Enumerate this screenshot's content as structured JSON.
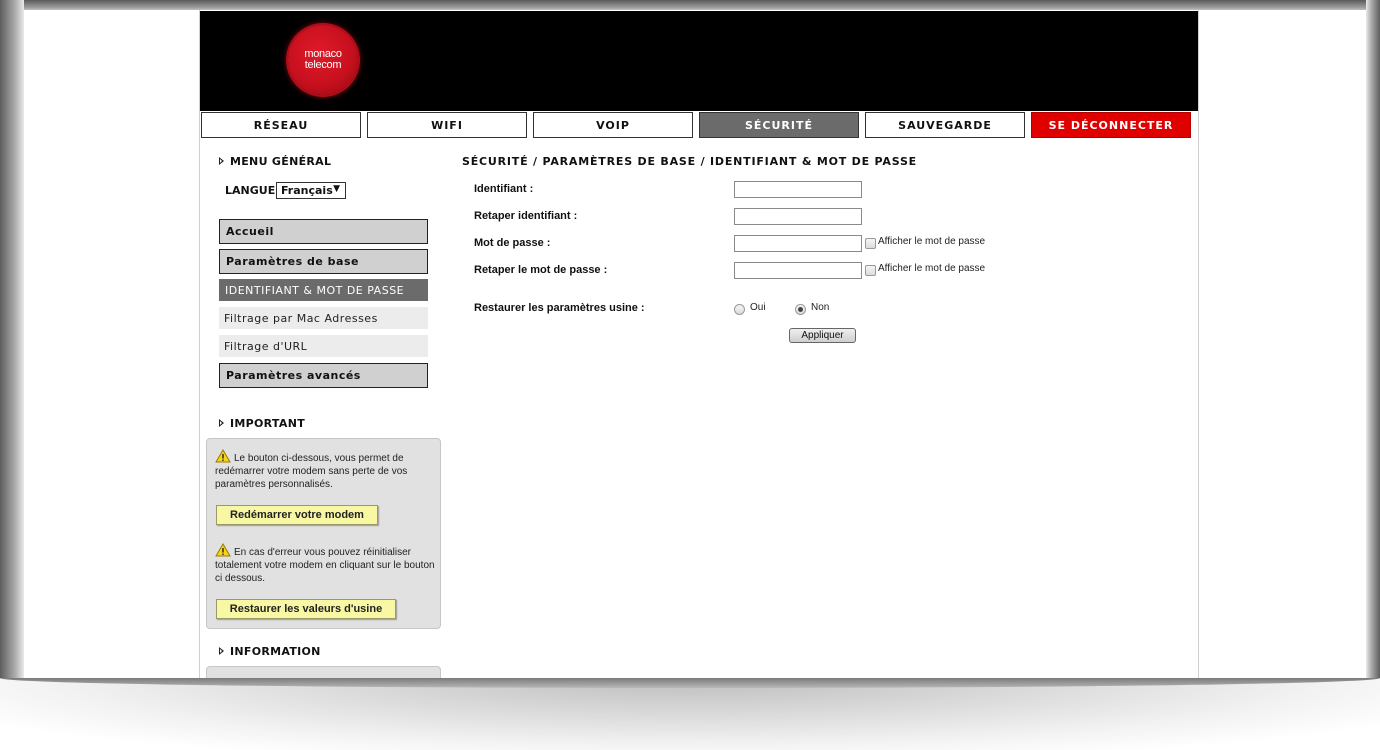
{
  "brand": {
    "logo_line1": "monaco",
    "logo_line2": "telecom"
  },
  "nav": {
    "items": [
      "RÉSEAU",
      "WIFI",
      "VOIP",
      "SÉCURITÉ",
      "SAUVEGARDE",
      "SE DÉCONNECTER"
    ],
    "active": "SÉCURITÉ"
  },
  "sidebar": {
    "menu_title": "MENU GÉNÉRAL",
    "lang_label": "LANGUE",
    "lang_value": "Français",
    "items": [
      "Accueil",
      "Paramètres de base",
      "IDENTIFIANT & MOT DE PASSE",
      "Filtrage par Mac Adresses",
      "Filtrage d'URL",
      "Paramètres avancés"
    ],
    "important_title": "IMPORTANT",
    "important_text1": "Le bouton ci-dessous, vous permet de redémarrer votre modem sans perte de vos paramètres personnalisés.",
    "restart_button": "Redémarrer votre modem",
    "important_text2": "En cas d'erreur vous pouvez réinitialiser totalement votre modem en cliquant sur le bouton ci dessous.",
    "factory_button": "Restaurer les valeurs d'usine",
    "information_title": "INFORMATION"
  },
  "form": {
    "title": "SÉCURITÉ / PARAMÈTRES DE BASE / IDENTIFIANT & MOT DE PASSE",
    "identifiant_label": "Identifiant :",
    "identifiant_value": "",
    "retaper_identifiant_label": "Retaper identifiant :",
    "retaper_identifiant_value": "",
    "password_label": "Mot de passe :",
    "password_value": "",
    "retaper_password_label": "Retaper le mot de passe :",
    "retaper_password_value": "",
    "show_password_label": "Afficher le mot de passe",
    "restore_label": "Restaurer les paramètres usine :",
    "restore_options": [
      "Oui",
      "Non"
    ],
    "restore_selected": "Non",
    "apply_button": "Appliquer"
  }
}
